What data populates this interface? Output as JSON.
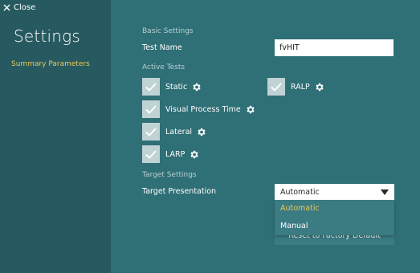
{
  "header": {
    "close_label": "Close"
  },
  "sidebar": {
    "title": "Settings",
    "items": [
      {
        "label": "Summary Parameters",
        "active": true
      }
    ]
  },
  "basic_settings": {
    "section_label": "Basic Settings",
    "test_name_label": "Test Name",
    "test_name_value": "fvHIT"
  },
  "active_tests": {
    "section_label": "Active Tests",
    "tests": [
      {
        "label": "Static",
        "checked": true,
        "icon": "gear-icon"
      },
      {
        "label": "Visual Process Time",
        "checked": true,
        "icon": "gear-icon"
      },
      {
        "label": "Lateral",
        "checked": true,
        "icon": "gear-icon"
      },
      {
        "label": "LARP",
        "checked": true,
        "icon": "gear-icon"
      },
      {
        "label": "RALP",
        "checked": true,
        "icon": "gear-icon"
      }
    ]
  },
  "target_settings": {
    "section_label": "Target Settings",
    "presentation_label": "Target Presentation",
    "selected": "Automatic",
    "options": [
      "Automatic",
      "Manual"
    ]
  },
  "factory_reset_label": "Reset to Factory Default",
  "colors": {
    "background": "#2f6f76",
    "sidebar": "#275a60",
    "accent": "#e9c85a",
    "checkbox": "#bfd2d4"
  }
}
